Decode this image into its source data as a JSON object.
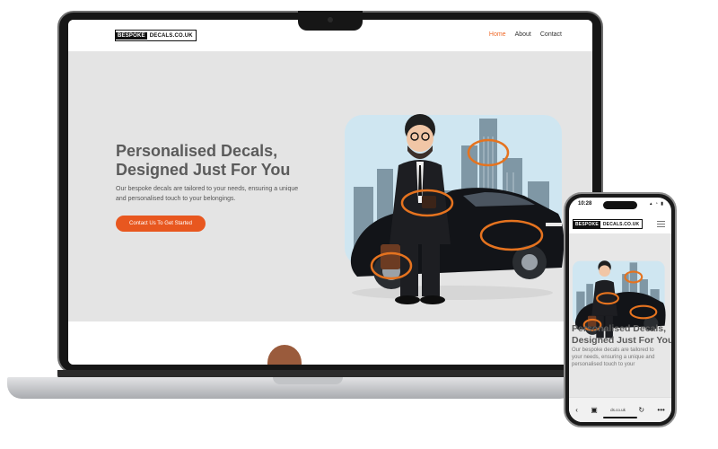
{
  "site": {
    "logo_left": "BESPOKE",
    "logo_right": "DECALS.CO.UK",
    "nav": [
      {
        "label": "Home",
        "active": true
      },
      {
        "label": "About",
        "active": false
      },
      {
        "label": "Contact",
        "active": false
      }
    ],
    "hero": {
      "title_lines": [
        "Personalised Decals,",
        "Designed Just For You"
      ],
      "text_lines": [
        "Our bespoke decals are tailored to your needs, ensuring a unique",
        "and personalised touch to your belongings."
      ],
      "cta_label": "Contact Us To Get Started"
    }
  },
  "phone": {
    "time": "10:28",
    "status_icons": "▴ ◔ ▮",
    "hero": {
      "title_lines": [
        "Personalised Decals,",
        "Designed Just For You"
      ],
      "text_lines": [
        "Our bespoke decals are tailored to",
        "your needs, ensuring a unique and",
        "personalised touch to your"
      ]
    },
    "toolbar": {
      "back": "‹",
      "tabs": "▣",
      "url": "ds.co.uk",
      "reload": "↻",
      "more": "•••"
    }
  },
  "colors": {
    "accent": "#e8571f",
    "nav_active": "#ef6a2a",
    "hero_bg": "#e4e4e4",
    "title": "#5b5b5b",
    "highlight_ring": "#e5731f"
  },
  "icons": {
    "menu": "hamburger-icon",
    "back": "back-arrow-icon",
    "tabs": "tabs-icon",
    "reload": "reload-icon",
    "more": "more-icon"
  }
}
